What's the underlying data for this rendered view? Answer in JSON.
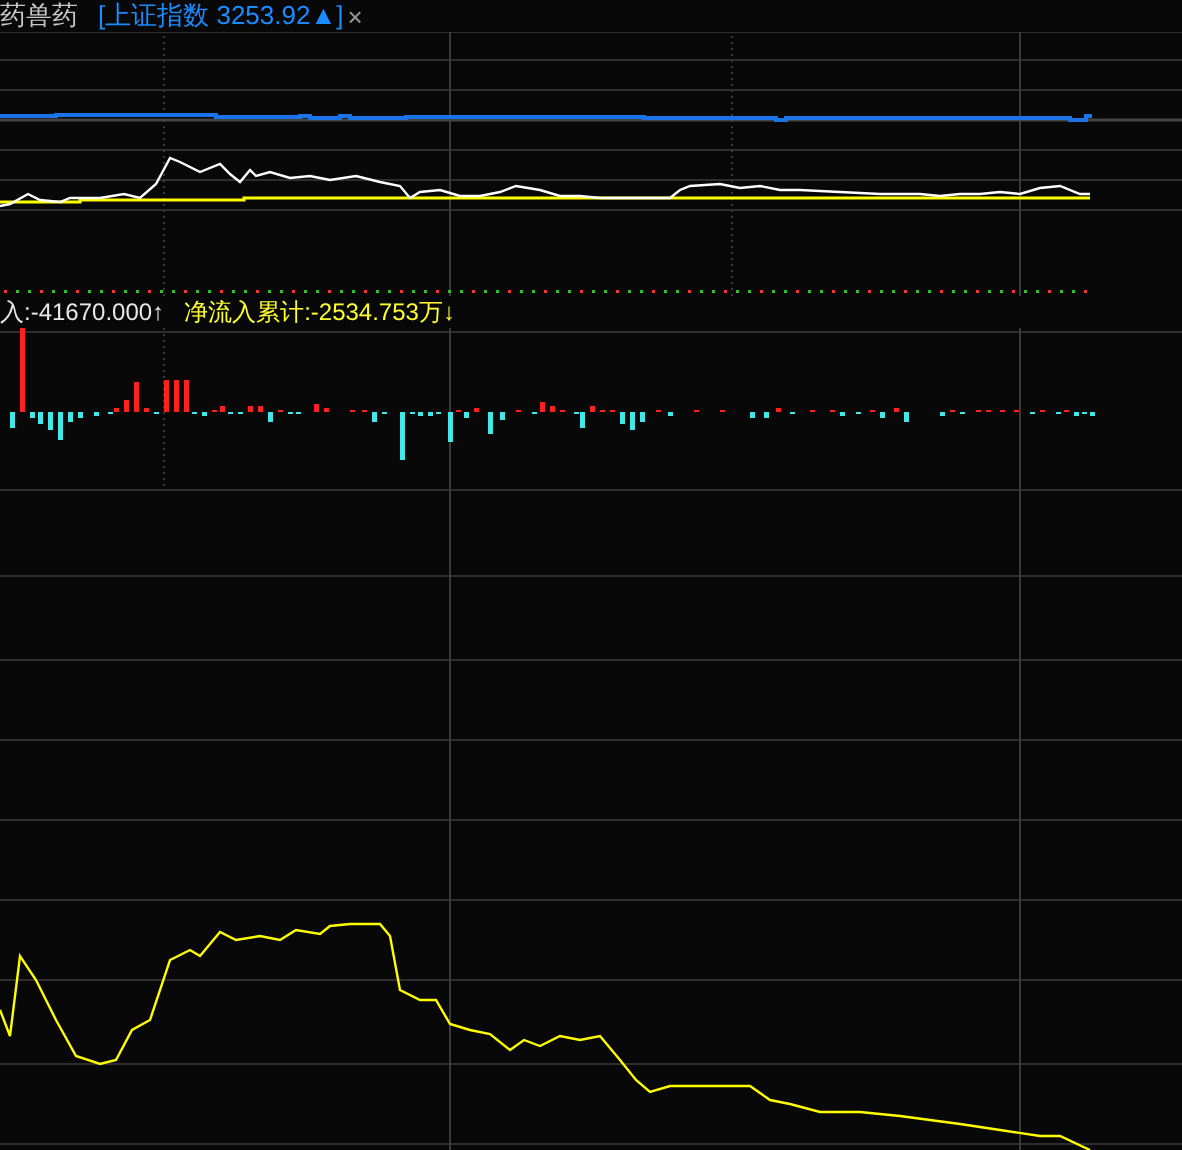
{
  "header": {
    "stock_name": "药兽药",
    "index_label": "[上证指数 3253.92▲]",
    "close": "×"
  },
  "flow": {
    "net_inflow": "入:-41670.000↑",
    "cumulative": "净流入累计:-2534.753万↓"
  }
}
